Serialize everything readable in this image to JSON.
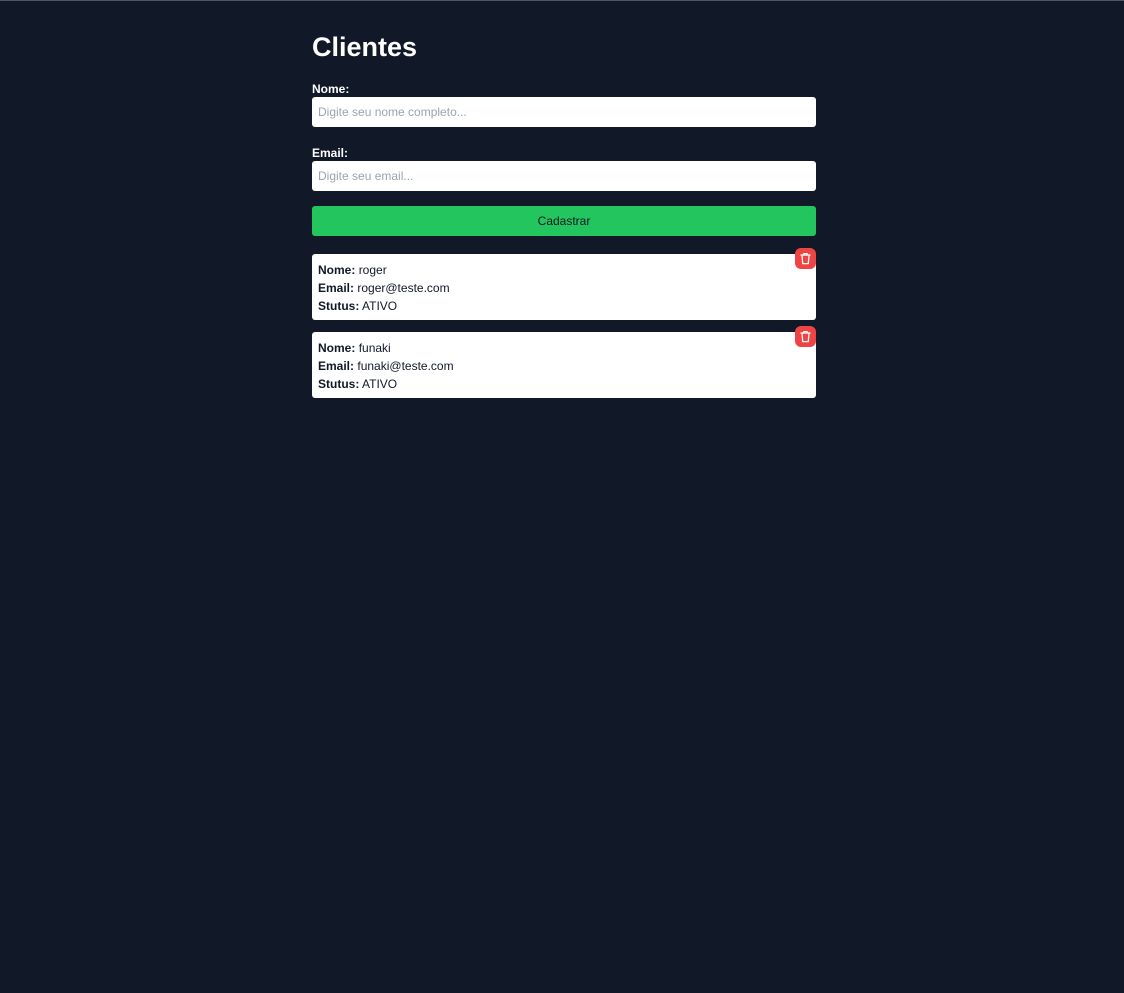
{
  "page": {
    "title": "Clientes"
  },
  "form": {
    "name_label": "Nome:",
    "name_placeholder": "Digite seu nome completo...",
    "name_value": "",
    "email_label": "Email:",
    "email_placeholder": "Digite seu email...",
    "email_value": "",
    "submit_label": "Cadastrar"
  },
  "list": {
    "name_key": "Nome:",
    "email_key": "Email:",
    "status_key": "Stutus:",
    "clients": [
      {
        "name": "roger",
        "email": "roger@teste.com",
        "status": "ATIVO"
      },
      {
        "name": "funaki",
        "email": "funaki@teste.com",
        "status": "ATIVO"
      }
    ],
    "delete_icon": "trash-icon"
  },
  "colors": {
    "background": "#111827",
    "accent": "#22c55e",
    "danger": "#ef4444",
    "card": "#ffffff"
  }
}
